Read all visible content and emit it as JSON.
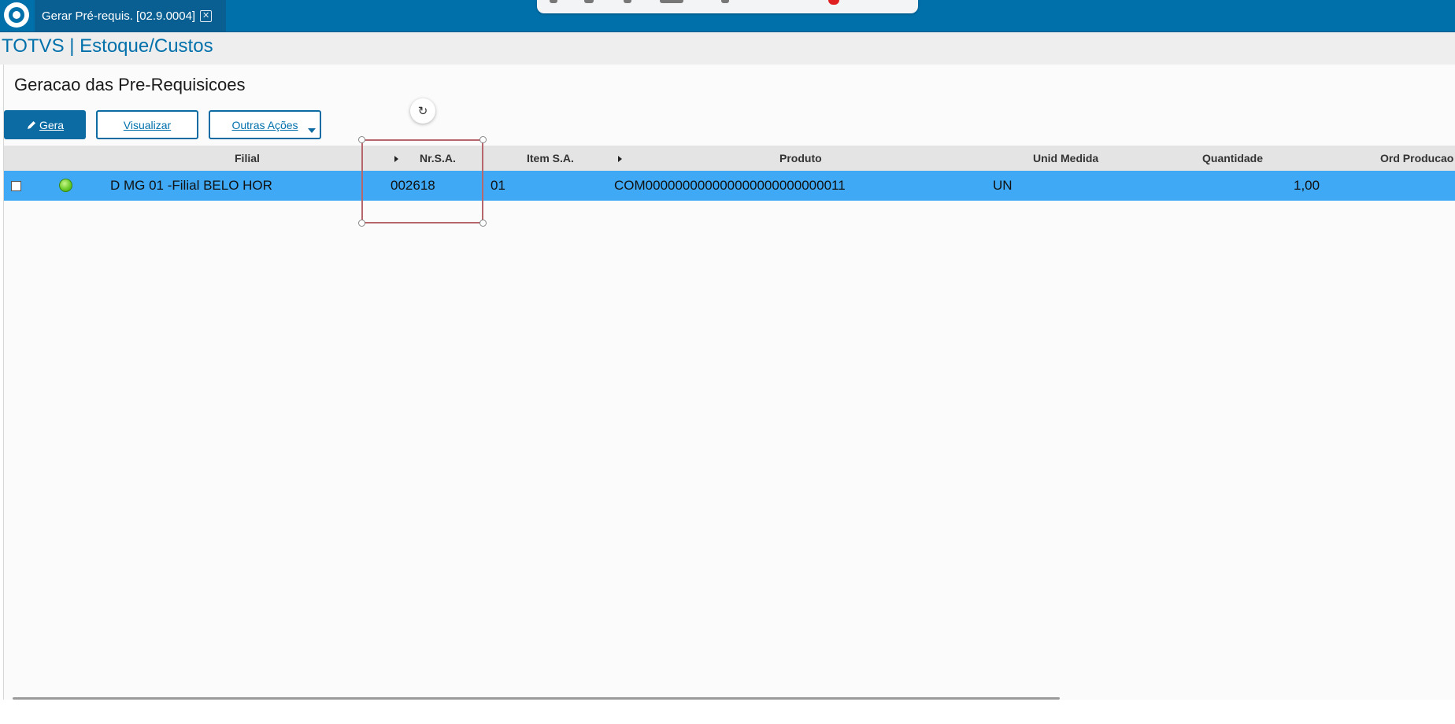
{
  "window": {
    "tab_title": "Gerar Pré-requis. [02.9.0004]",
    "close_glyph": "✕"
  },
  "module": {
    "title": "TOTVS | Estoque/Custos"
  },
  "page": {
    "title": "Geracao das Pre-Requisicoes"
  },
  "toolbar": {
    "gera_label": "Gera",
    "visualizar_label": "Visualizar",
    "outras_label": "Outras Ações"
  },
  "grid": {
    "columns": {
      "filial": "Filial",
      "nrsa": "Nr.S.A.",
      "item": "Item S.A.",
      "produto": "Produto",
      "unid": "Unid Medida",
      "quantidade": "Quantidade",
      "ordprod": "Ord Producao"
    },
    "rows": [
      {
        "status": "green",
        "filial": "D MG 01 -Filial BELO HOR",
        "nrsa": "002618",
        "item": "01",
        "produto": "COM000000000000000000000000011",
        "unid": "UN",
        "quantidade": "1,00",
        "ordprod": ""
      }
    ]
  },
  "colors": {
    "header_blue": "#0070ab",
    "selected_row": "#3fa9f5",
    "status_green": "#6ccc2a",
    "selection_box": "#b5676c"
  },
  "icons": [
    "totvs-logo-icon",
    "close-icon",
    "pencil-icon",
    "dropdown-caret-icon",
    "sort-arrow-icon",
    "rotate-help-icon",
    "status-led-icon",
    "checkbox-icon"
  ]
}
